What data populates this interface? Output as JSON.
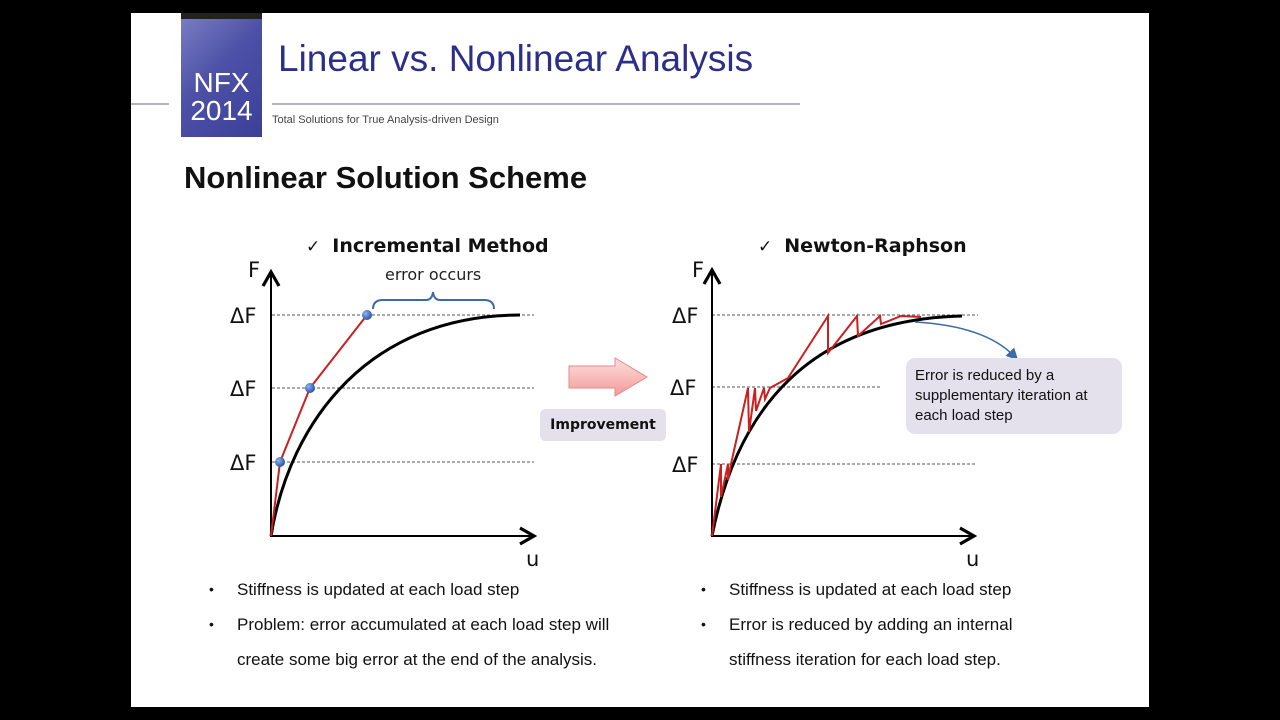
{
  "header": {
    "logo_line1": "NFX",
    "logo_line2": "2014",
    "title": "Linear vs. Nonlinear Analysis",
    "subtitle": "Total Solutions for True Analysis-driven Design"
  },
  "section_title": "Nonlinear Solution Scheme",
  "left_panel": {
    "heading": "Incremental Method",
    "check_icon": "✓",
    "y_axis_label": "F",
    "x_axis_label": "u",
    "load_labels": [
      "ΔF",
      "ΔF",
      "ΔF"
    ],
    "annotation": "error occurs",
    "bullets": [
      "Stiffness is updated at each load step",
      "Problem: error accumulated at each load step will create some big error at the end of the analysis."
    ]
  },
  "arrow": {
    "label": "Improvement",
    "color": "#f4a9a8"
  },
  "right_panel": {
    "heading": "Newton-Raphson",
    "check_icon": "✓",
    "y_axis_label": "F",
    "x_axis_label": "u",
    "load_labels": [
      "ΔF",
      "ΔF",
      "ΔF"
    ],
    "callout": "Error is reduced by a supplementary iteration at each load step",
    "bullets": [
      "Stiffness is updated at each load step",
      "Error is reduced by adding an internal stiffness iteration for each load step."
    ]
  },
  "colors": {
    "title": "#2b2f8a",
    "curve": "#000000",
    "iteration": "#cc1f1f",
    "marker": "#3a6fc4",
    "callout_bg": "#e4e1ec"
  },
  "bullet_glyph": "•"
}
